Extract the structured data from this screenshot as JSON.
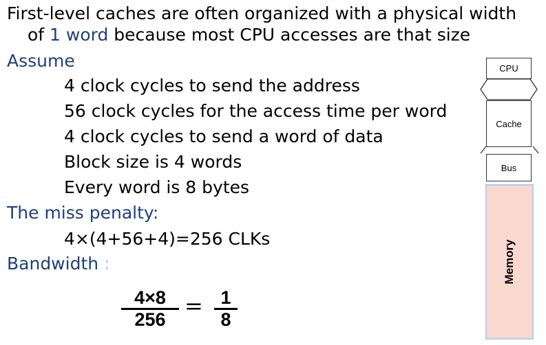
{
  "slide": {
    "intro_part1": "First-level caches are often organized with a physical width",
    "intro_part2a": "of ",
    "intro_highlight": "1 word",
    "intro_part2b": " because most CPU accesses are that size",
    "assume_heading": "Assume",
    "assumptions": [
      "4  clock cycles to send the address",
      "56 clock cycles for the access time per word",
      "4 clock cycles to send a word of data",
      "Block size is 4 words",
      "Every word is 8 bytes"
    ],
    "miss_penalty_heading": "The miss penalty:",
    "miss_penalty_formula": "4×(4+56+4)=256 CLKs",
    "bandwidth_heading": "Bandwidth",
    "bandwidth_colon": ":",
    "fraction_left_numerator": "4×8",
    "fraction_left_denominator": "256",
    "equals": "=",
    "fraction_right_numerator": "1",
    "fraction_right_denominator": "8"
  },
  "diagram": {
    "cpu": "CPU",
    "cache": "Cache",
    "bus": "Bus",
    "memory": "Memory"
  }
}
